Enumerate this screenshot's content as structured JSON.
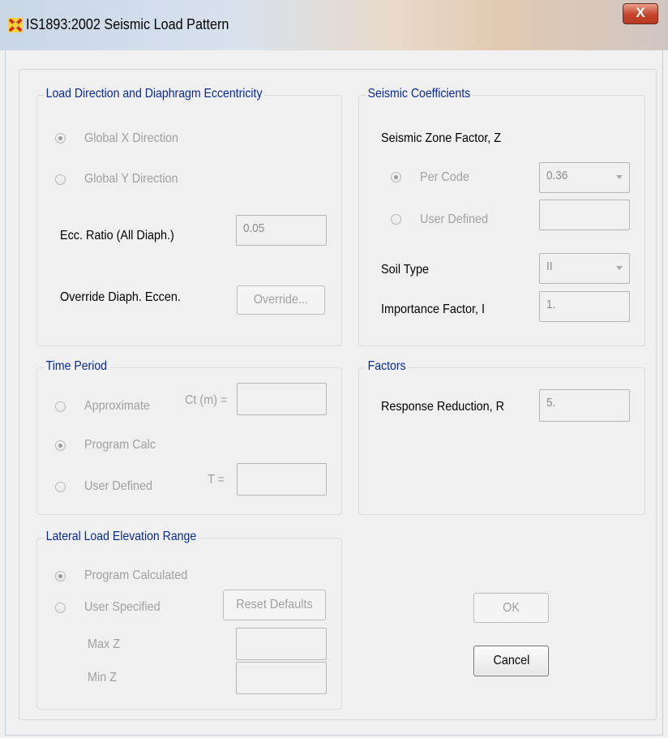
{
  "window": {
    "title": "IS1893:2002 Seismic Load Pattern",
    "close_label": "X"
  },
  "load_direction": {
    "legend": "Load Direction and Diaphragm Eccentricity",
    "global_x": "Global  X  Direction",
    "global_y": "Global  Y  Direction",
    "ecc_label": "Ecc. Ratio (All Diaph.)",
    "ecc_value": "0.05",
    "override_label": "Override Diaph. Eccen.",
    "override_button": "Override..."
  },
  "seismic_coefficients": {
    "legend": "Seismic Coefficients",
    "zone_factor_label": "Seismic Zone Factor, Z",
    "per_code": "Per Code",
    "per_code_value": "0.36",
    "user_defined": "User Defined",
    "user_defined_value": "",
    "soil_type_label": "Soil Type",
    "soil_type_value": "II",
    "importance_label": "Importance Factor, I",
    "importance_value": "1."
  },
  "time_period": {
    "legend": "Time Period",
    "approximate": "Approximate",
    "ct_label": "Ct (m) =",
    "ct_value": "",
    "program_calc": "Program Calc",
    "user_defined": "User Defined",
    "t_label": "T =",
    "t_value": ""
  },
  "factors": {
    "legend": "Factors",
    "response_label": "Response Reduction, R",
    "response_value": "5."
  },
  "elevation": {
    "legend": "Lateral Load Elevation Range",
    "program_calculated": "Program Calculated",
    "user_specified": "User Specified",
    "reset_button": "Reset Defaults",
    "max_z_label": "Max Z",
    "max_z_value": "",
    "min_z_label": "Min Z",
    "min_z_value": ""
  },
  "buttons": {
    "ok": "OK",
    "cancel": "Cancel"
  }
}
